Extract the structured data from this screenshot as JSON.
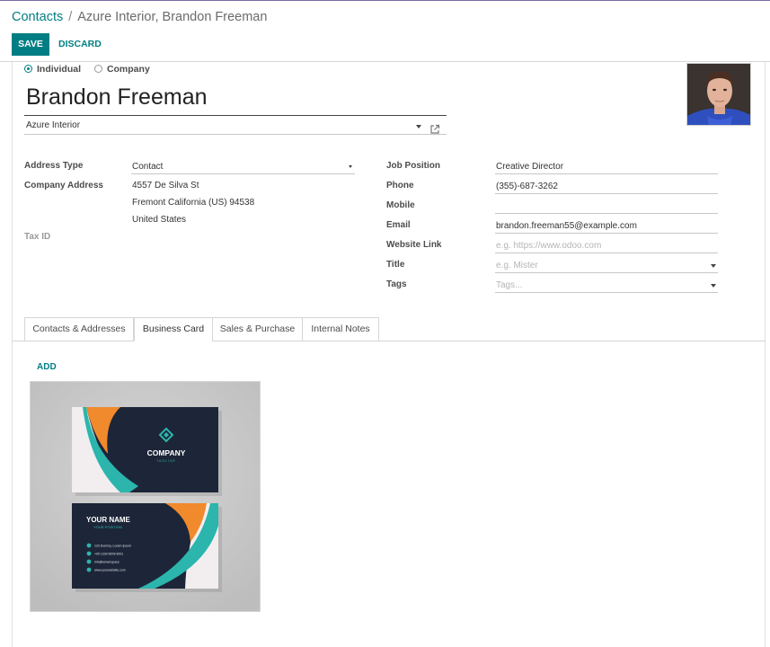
{
  "breadcrumb": {
    "parent": "Contacts",
    "separator": "/",
    "current": "Azure Interior, Brandon Freeman"
  },
  "toolbar": {
    "save_label": "SAVE",
    "discard_label": "DISCARD"
  },
  "company_type": {
    "options": [
      "Individual",
      "Company"
    ],
    "selected": "Individual"
  },
  "contact": {
    "name": "Brandon Freeman",
    "parent_company": "Azure Interior"
  },
  "left_fields": {
    "address_type_label": "Address Type",
    "address_type_value": "Contact",
    "company_address_label": "Company Address",
    "street": "4557 De Silva St",
    "city_line": "Fremont  California (US)  94538",
    "country": "United States",
    "tax_id_label": "Tax ID"
  },
  "right_fields": {
    "job_position_label": "Job Position",
    "job_position_value": "Creative Director",
    "phone_label": "Phone",
    "phone_value": "(355)-687-3262",
    "mobile_label": "Mobile",
    "mobile_value": "",
    "email_label": "Email",
    "email_value": "brandon.freeman55@example.com",
    "website_label": "Website Link",
    "website_placeholder": "e.g. https://www.odoo.com",
    "title_label": "Title",
    "title_placeholder": "e.g. Mister",
    "tags_label": "Tags",
    "tags_placeholder": "Tags..."
  },
  "tabs": [
    {
      "label": "Contacts & Addresses",
      "active": false
    },
    {
      "label": "Business Card",
      "active": true
    },
    {
      "label": "Sales & Purchase",
      "active": false
    },
    {
      "label": "Internal Notes",
      "active": false
    }
  ],
  "business_card": {
    "add_label": "ADD",
    "front_company": "COMPANY",
    "front_tagline": "TAGLINE",
    "back_name": "YOUR NAME",
    "back_position": "YOUR POSITION",
    "back_lines": [
      "123 Dummy, Lorem Ipsum",
      "+00 1234 5678 9001",
      "info@email.space",
      "www.yourwebsite.com"
    ]
  },
  "colors": {
    "accent": "#017e84",
    "card_dark": "#1d2638",
    "card_teal": "#2bb5ad",
    "card_orange": "#f08a2c"
  }
}
